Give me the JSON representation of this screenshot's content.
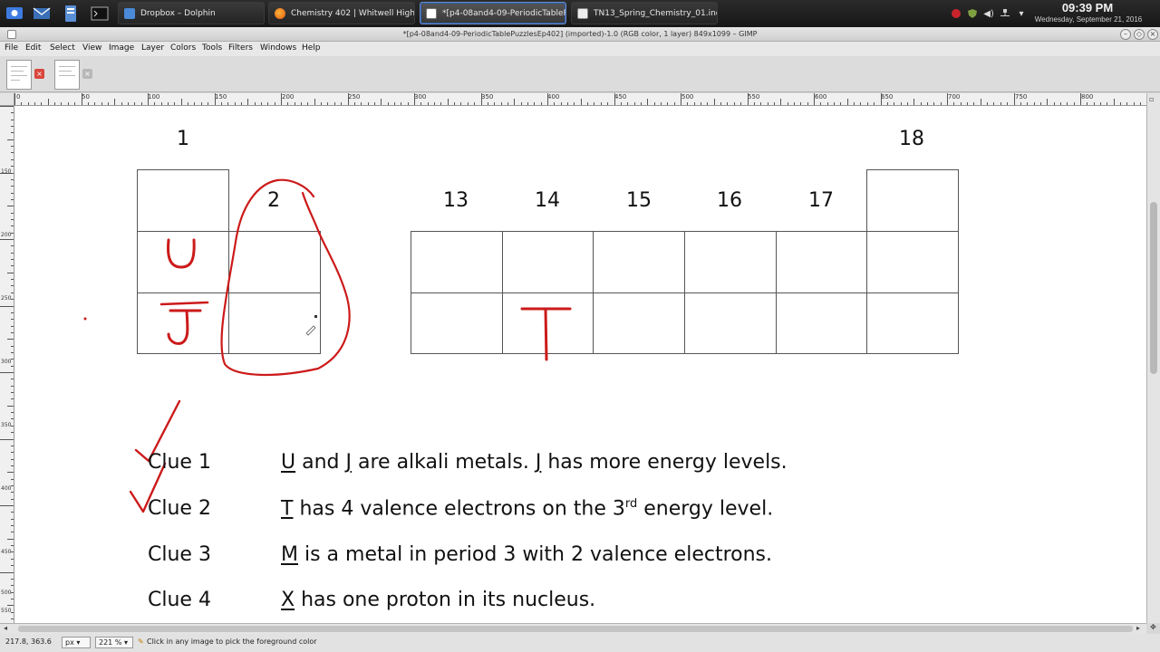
{
  "taskbar": {
    "tasks": [
      {
        "label": "Dropbox – Dolphin",
        "active": false
      },
      {
        "label": "Chemistry 402 | Whitwell High Scho",
        "active": false
      },
      {
        "label": "*[p4-08and4-09-PeriodicTablePuzzle",
        "active": true
      },
      {
        "label": "TN13_Spring_Chemistry_01.indd - C",
        "active": false
      }
    ],
    "clock_time": "09:39 PM",
    "clock_date": "Wednesday, September 21, 2016"
  },
  "window": {
    "title": "*[p4-08and4-09-PeriodicTablePuzzlesEp402] (imported)-1.0 (RGB color, 1 layer) 849x1099 – GIMP"
  },
  "menu": [
    "File",
    "Edit",
    "Select",
    "View",
    "Image",
    "Layer",
    "Colors",
    "Tools",
    "Filters",
    "Windows",
    "Help"
  ],
  "ruler": {
    "h_labels": [
      "0",
      "50",
      "100",
      "150",
      "200",
      "250",
      "300",
      "350",
      "400",
      "450",
      "500",
      "550",
      "600",
      "650",
      "700",
      "750",
      "800"
    ],
    "v_labels": [
      "150",
      "200",
      "250",
      "300",
      "350",
      "400",
      "450",
      "500",
      "550"
    ]
  },
  "canvas": {
    "groups": {
      "g1": "1",
      "g2": "2",
      "g13": "13",
      "g14": "14",
      "g15": "15",
      "g16": "16",
      "g17": "17",
      "g18": "18"
    },
    "handwritten": {
      "u": "U",
      "j": "J",
      "t": "T"
    },
    "clues": [
      {
        "label": "Clue 1",
        "symbol": "U",
        "parts": [
          " and ",
          "J",
          " are alkali metals. ",
          "J",
          " has more energy levels."
        ]
      },
      {
        "label": "Clue 2",
        "symbol": "T",
        "text_a": " has 4 valence electrons on the 3",
        "sup": "rd",
        "text_b": " energy level."
      },
      {
        "label": "Clue 3",
        "symbol": "M",
        "text": " is a metal in period 3 with 2 valence electrons."
      },
      {
        "label": "Clue 4",
        "symbol": "X",
        "text": " has one proton in its nucleus."
      }
    ]
  },
  "status": {
    "coords": "217.8, 363.6",
    "unit": "px",
    "zoom": "221 %",
    "message": "Click in any image to pick the foreground color"
  },
  "colors": {
    "ink": "#cc1a1a",
    "accent": "#2d5ca8"
  }
}
